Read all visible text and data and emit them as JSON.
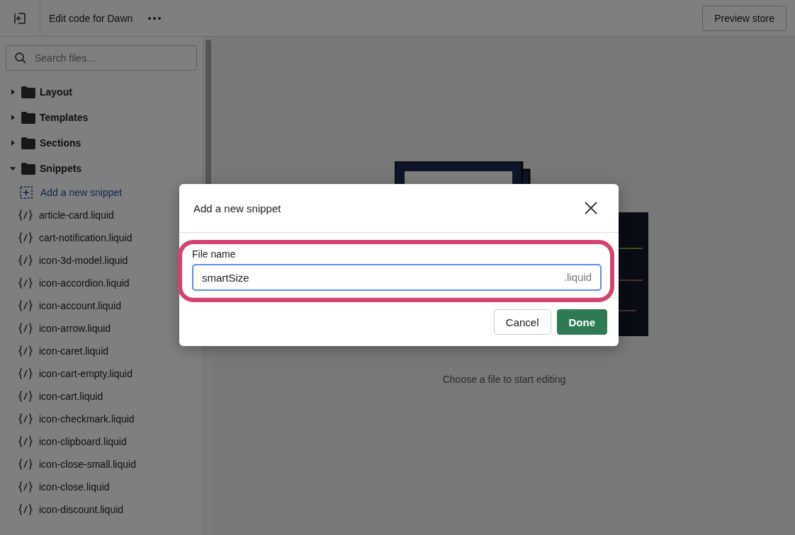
{
  "top_bar": {
    "title": "Edit code for Dawn",
    "preview_button": "Preview store"
  },
  "search": {
    "placeholder": "Search files..."
  },
  "tree": [
    {
      "name": "Layout",
      "expanded": false
    },
    {
      "name": "Templates",
      "expanded": false
    },
    {
      "name": "Sections",
      "expanded": false
    },
    {
      "name": "Snippets",
      "expanded": true,
      "children": [
        {
          "kind": "action",
          "name": "Add a new snippet"
        },
        {
          "kind": "file",
          "name": "article-card.liquid"
        },
        {
          "kind": "file",
          "name": "cart-notification.liquid"
        },
        {
          "kind": "file",
          "name": "icon-3d-model.liquid"
        },
        {
          "kind": "file",
          "name": "icon-accordion.liquid"
        },
        {
          "kind": "file",
          "name": "icon-account.liquid"
        },
        {
          "kind": "file",
          "name": "icon-arrow.liquid"
        },
        {
          "kind": "file",
          "name": "icon-caret.liquid"
        },
        {
          "kind": "file",
          "name": "icon-cart-empty.liquid"
        },
        {
          "kind": "file",
          "name": "icon-cart.liquid"
        },
        {
          "kind": "file",
          "name": "icon-checkmark.liquid"
        },
        {
          "kind": "file",
          "name": "icon-clipboard.liquid"
        },
        {
          "kind": "file",
          "name": "icon-close-small.liquid"
        },
        {
          "kind": "file",
          "name": "icon-close.liquid"
        },
        {
          "kind": "file",
          "name": "icon-discount.liquid"
        }
      ]
    }
  ],
  "empty_state": {
    "text": "Choose a file to start editing"
  },
  "dialog": {
    "title": "Add a new snippet",
    "field": {
      "label": "File name",
      "value": "smartSize",
      "suffix": ".liquid"
    },
    "buttons": [
      {
        "label": "Cancel",
        "kind": "secondary"
      },
      {
        "label": "Done",
        "kind": "primary"
      }
    ]
  }
}
